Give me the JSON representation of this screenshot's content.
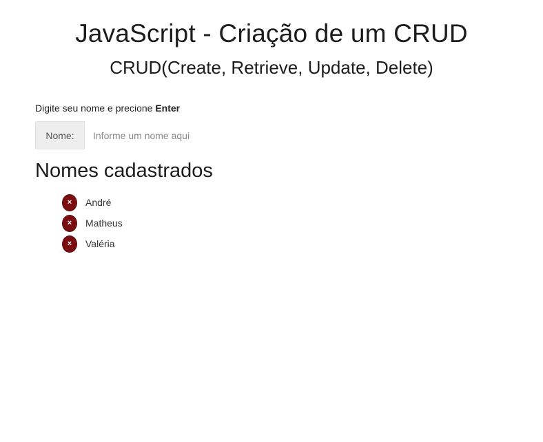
{
  "header": {
    "title": "JavaScript - Criação de um CRUD",
    "subtitle": "CRUD(Create, Retrieve, Update, Delete)"
  },
  "form": {
    "instruction_prefix": "Digite seu nome e precione ",
    "instruction_key": "Enter",
    "name_label": "Nome:",
    "name_value": "",
    "name_placeholder": "Informe um nome aqui"
  },
  "list": {
    "title": "Nomes cadastrados",
    "remove_glyph": "×",
    "items": [
      {
        "name": "André"
      },
      {
        "name": "Matheus"
      },
      {
        "name": "Valéria"
      }
    ]
  },
  "colors": {
    "remove_button": "#7a0f12",
    "addon_background": "#eeeeee"
  }
}
